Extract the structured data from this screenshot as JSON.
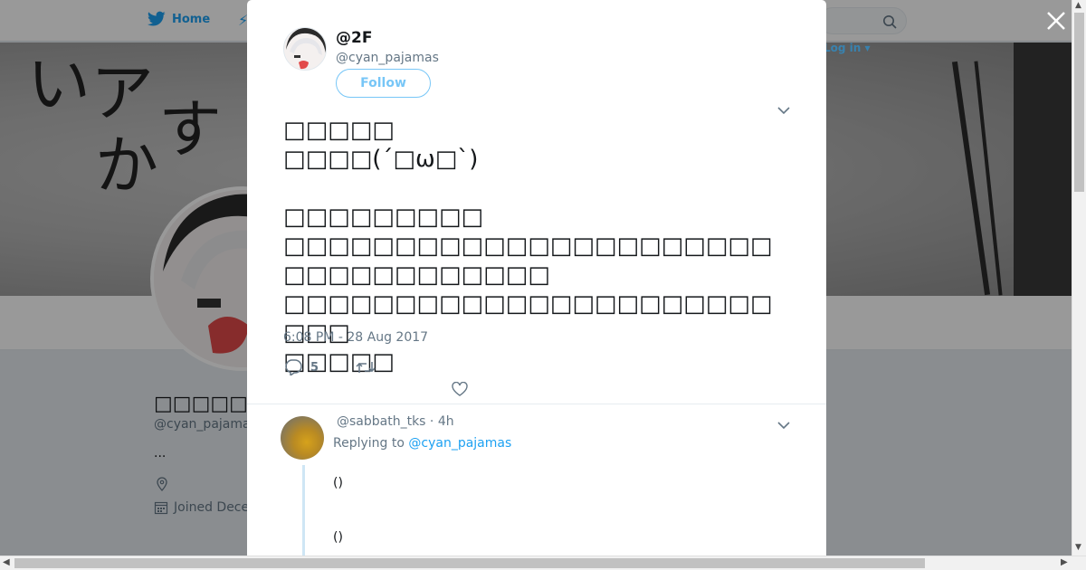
{
  "nav": {
    "home_label": "Home",
    "login_label": "Log in ▾"
  },
  "profile": {
    "display_name": "□□□□□□□□□",
    "handle": "@cyan_pajamas",
    "bio": "...",
    "joined": "Joined Dece"
  },
  "tweet": {
    "display_name": "@2F",
    "handle": "@cyan_pajamas",
    "follow_label": "Follow",
    "text": "□□□□□\n□□□□(´□ω□`)\n\n□□□□□□□□□\n□□□□□□□□□□□□□□□□□□□□□□□□□□□□□□□□□□\n□□□□□□□□□□□□□□□□□□□□□□□□□\n□□□□□",
    "timestamp": "6:08 PM - 28 Aug 2017",
    "reply_count": "5"
  },
  "reply": {
    "handle_time": "@sabbath_tks · 4h",
    "replying_prefix": "Replying to ",
    "replying_handle": "@cyan_pajamas",
    "line1": "()",
    "line2": "()"
  },
  "icons": {
    "brand": "twitter-bird-icon",
    "close": "close-icon",
    "caret": "chevron-down-icon",
    "reply": "reply-icon",
    "retweet": "retweet-icon",
    "like": "heart-icon",
    "location": "location-icon",
    "calendar": "calendar-icon",
    "search": "search-icon"
  },
  "colors": {
    "accent": "#1da1f2",
    "muted": "#657786",
    "overlay": "rgba(0,0,0,0.4)"
  }
}
